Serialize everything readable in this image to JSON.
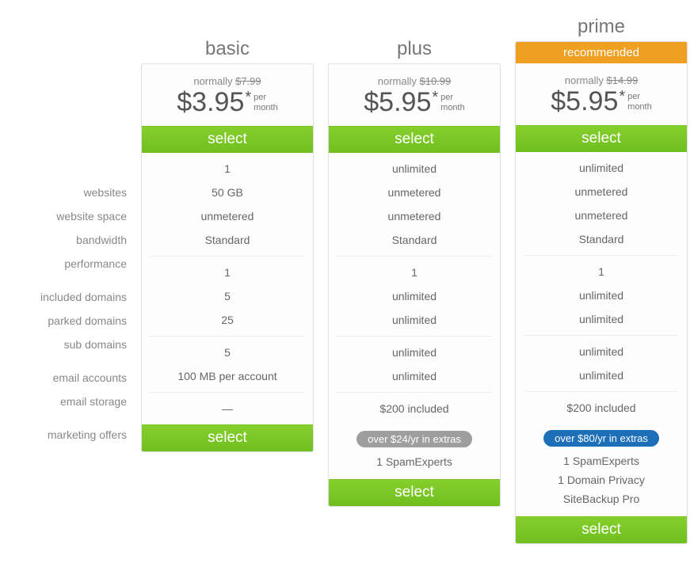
{
  "labels": {
    "group1": [
      "websites",
      "website space",
      "bandwidth",
      "performance"
    ],
    "group2": [
      "included domains",
      "parked domains",
      "sub domains"
    ],
    "group3": [
      "email accounts",
      "email storage"
    ],
    "group4": [
      "marketing offers"
    ]
  },
  "normally_label": "normally",
  "per_label_1": "per",
  "per_label_2": "month",
  "select_label": "select",
  "recommended_label": "recommended",
  "plans": {
    "basic": {
      "title": "basic",
      "old_price": "$7.99",
      "price": "$3.95",
      "g1": [
        "1",
        "50 GB",
        "unmetered",
        "Standard"
      ],
      "g2": [
        "1",
        "5",
        "25"
      ],
      "g3": [
        "5",
        "100 MB per account"
      ],
      "g4": [
        "—"
      ],
      "extras_badge": null,
      "extras": []
    },
    "plus": {
      "title": "plus",
      "old_price": "$10.99",
      "price": "$5.95",
      "g1": [
        "unlimited",
        "unmetered",
        "unmetered",
        "Standard"
      ],
      "g2": [
        "1",
        "unlimited",
        "unlimited"
      ],
      "g3": [
        "unlimited",
        "unlimited"
      ],
      "g4": [
        "$200 included"
      ],
      "extras_badge": "over $24/yr in extras",
      "extras_badge_color": "gray",
      "extras": [
        "1 SpamExperts"
      ]
    },
    "prime": {
      "title": "prime",
      "old_price": "$14.99",
      "price": "$5.95",
      "g1": [
        "unlimited",
        "unmetered",
        "unmetered",
        "Standard"
      ],
      "g2": [
        "1",
        "unlimited",
        "unlimited"
      ],
      "g3": [
        "unlimited",
        "unlimited"
      ],
      "g4": [
        "$200 included"
      ],
      "extras_badge": "over $80/yr in extras",
      "extras_badge_color": "blue",
      "extras": [
        "1 SpamExperts",
        "1 Domain Privacy",
        "SiteBackup Pro"
      ]
    }
  }
}
